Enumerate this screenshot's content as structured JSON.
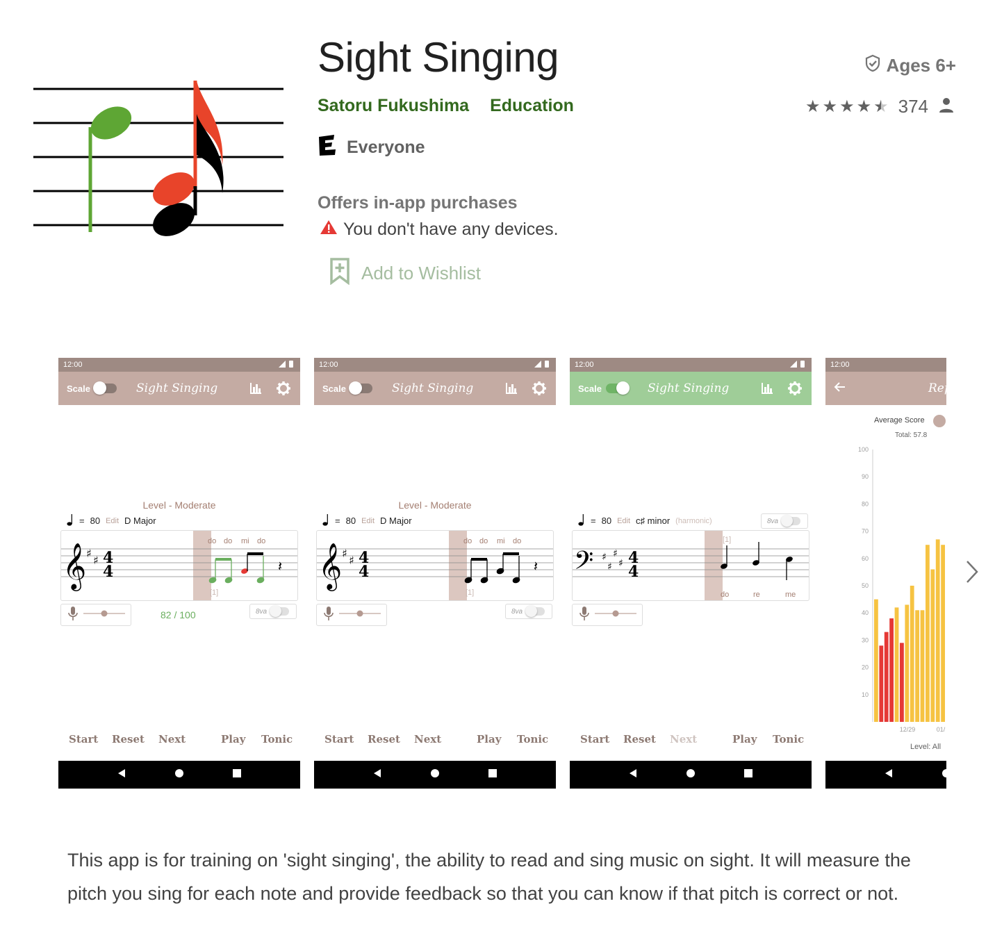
{
  "app": {
    "title": "Sight Singing",
    "developer": "Satoru Fukushima",
    "category": "Education",
    "age_rating": "Ages 6+",
    "rating_count": "374",
    "rating_value": 4.5,
    "content_rating": "Everyone",
    "iap_text": "Offers in-app purchases",
    "device_warning": "You don't have any devices.",
    "wishlist_label": "Add to Wishlist",
    "description": "This app is for training on 'sight singing', the ability to read and sing music on sight. It will measure the pitch you sing for each note and provide feedback so that you can know if that pitch is correct or not."
  },
  "colors": {
    "developer_link": "#33691e",
    "toolbar_default": "#c4aba3",
    "toolbar_active": "#9fcd98",
    "statusbar": "#9e8a83",
    "bar_red": "#e53935",
    "bar_yellow": "#f6c342"
  },
  "screenshots": [
    {
      "time": "12:00",
      "scale_label": "Scale",
      "app_title": "Sight Singing",
      "level": "Level - Moderate",
      "tempo": "80",
      "edit": "Edit",
      "key": "D Major",
      "solfege": [
        "do",
        "do",
        "mi",
        "do"
      ],
      "measure": "[1]",
      "score": "82 / 100",
      "octave_label": "8va",
      "buttons": {
        "start": "Start",
        "reset": "Reset",
        "next": "Next",
        "play": "Play",
        "tonic": "Tonic"
      }
    },
    {
      "time": "12:00",
      "scale_label": "Scale",
      "app_title": "Sight Singing",
      "level": "Level - Moderate",
      "tempo": "80",
      "edit": "Edit",
      "key": "D Major",
      "solfege": [
        "do",
        "do",
        "mi",
        "do"
      ],
      "measure": "[1]",
      "octave_label": "8va",
      "buttons": {
        "start": "Start",
        "reset": "Reset",
        "next": "Next",
        "play": "Play",
        "tonic": "Tonic"
      }
    },
    {
      "time": "12:00",
      "scale_label": "Scale",
      "app_title": "Sight Singing",
      "tempo": "80",
      "edit": "Edit",
      "key": "c♯ minor",
      "key_note": "(harmonic)",
      "solfege": [
        "do",
        "re",
        "me"
      ],
      "measure": "[1]",
      "octave_label": "8va",
      "buttons": {
        "start": "Start",
        "reset": "Reset",
        "next": "Next",
        "play": "Play",
        "tonic": "Tonic"
      }
    },
    {
      "time": "12:00",
      "title_partial": "Rep",
      "legend": "Average Score",
      "total": "Total: 57.8",
      "level_filter": "Level: All",
      "chart_data": {
        "type": "bar",
        "title": "",
        "series": [
          {
            "values": [
              45,
              28,
              33,
              38,
              42,
              29,
              43,
              50,
              41,
              41,
              65,
              56,
              67,
              65
            ]
          }
        ],
        "bar_colors": [
          "#f6c342",
          "#e53935",
          "#e53935",
          "#e53935",
          "#f6c342",
          "#e53935",
          "#f6c342",
          "#f6c342",
          "#f6c342",
          "#f6c342",
          "#f6c342",
          "#f6c342",
          "#f6c342",
          "#f6c342"
        ],
        "y_ticks": [
          "100",
          "90",
          "80",
          "70",
          "60",
          "50",
          "40",
          "30",
          "20",
          "10"
        ],
        "x_ticks": [
          "12/29",
          "01/"
        ],
        "ylim": [
          0,
          100
        ]
      }
    }
  ]
}
